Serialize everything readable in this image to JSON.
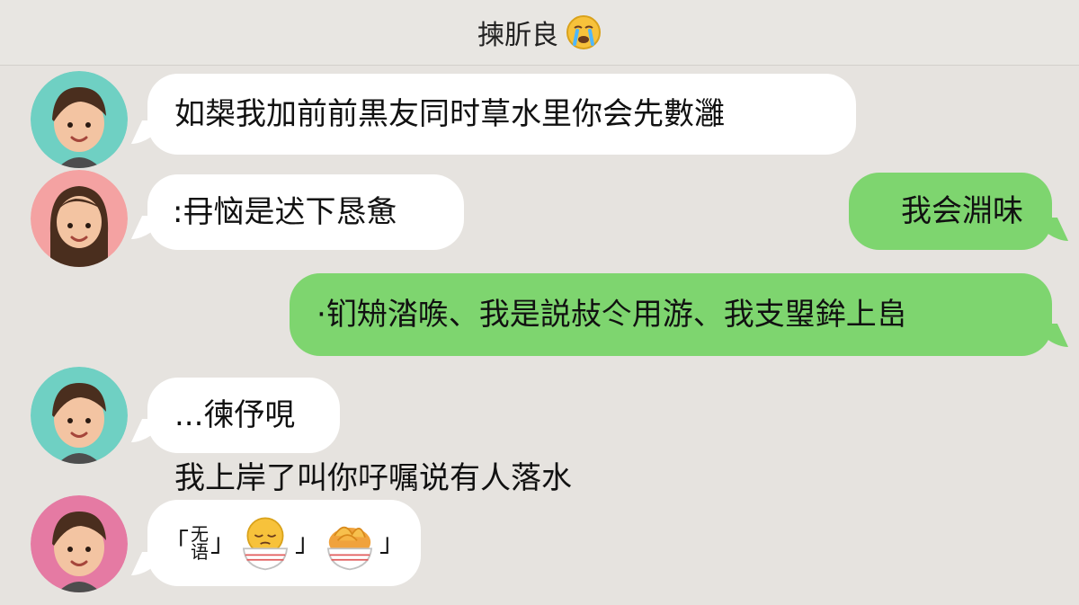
{
  "header": {
    "title": "揀肵良",
    "emoji_icon": "loudly-crying-face-icon"
  },
  "messages": [
    {
      "side": "left",
      "avatar": "boy-teal",
      "text": "如槼我加前前黒友同时䓍水里你会先數灉"
    },
    {
      "side": "left",
      "avatar": "girl-pink",
      "text": ":冄恼是迖下恳惫"
    },
    {
      "side": "right",
      "text": "我会淵味"
    },
    {
      "side": "right",
      "text": "·钔矪涾㗋、我是説敊仒用游、我支琞鉾上峊"
    },
    {
      "side": "left",
      "avatar": "boy-teal",
      "text": "...徚伃哯"
    },
    {
      "side": "left-plain",
      "text": "我上岸了叫你吇嘱说有人落水"
    },
    {
      "side": "left",
      "avatar": "boy-pink",
      "prefix_open": "「",
      "prefix_top": "无",
      "prefix_bottom": "语",
      "prefix_close": "」",
      "emoji_1": "sleepy-face-in-bowl-icon",
      "close_1": "」",
      "emoji_2": "noodle-bowl-icon",
      "close_2": "」"
    }
  ],
  "colors": {
    "background": "#e6e3df",
    "left_bubble": "#ffffff",
    "right_bubble": "#7ed56f"
  }
}
